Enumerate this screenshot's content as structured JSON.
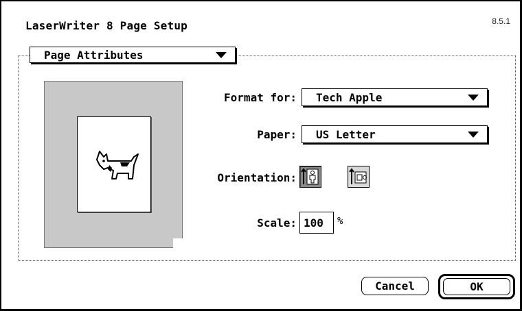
{
  "dialog": {
    "title": "LaserWriter 8 Page Setup",
    "version": "8.5.1"
  },
  "section": {
    "selected": "Page Attributes"
  },
  "preview": {
    "icon": "dogcow-icon"
  },
  "format_for": {
    "label": "Format for:",
    "value": "Tech Apple"
  },
  "paper": {
    "label": "Paper:",
    "value": "US Letter"
  },
  "orientation": {
    "label": "Orientation:",
    "options": [
      "portrait",
      "landscape"
    ],
    "selected": "portrait"
  },
  "scale": {
    "label": "Scale:",
    "value": "100",
    "unit": "%"
  },
  "buttons": {
    "cancel": "Cancel",
    "ok": "OK"
  }
}
